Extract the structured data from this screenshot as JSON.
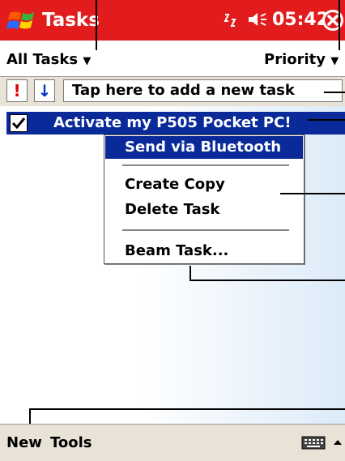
{
  "title_bar": {
    "app_title": "Tasks",
    "clock": "05:42"
  },
  "filter_bar": {
    "category": "All Tasks",
    "sort": "Priority"
  },
  "entry_bar": {
    "priority_symbol": "!",
    "sort_symbol": "↓",
    "new_task_placeholder": "Tap here to add a new task"
  },
  "task_list": {
    "tasks": [
      {
        "title": "Activate my P505 Pocket PC!",
        "checked": true
      }
    ]
  },
  "context_menu": {
    "items": [
      {
        "label": "Send via Bluetooth",
        "highlighted": true
      },
      {
        "label": "Create Copy"
      },
      {
        "label": "Delete Task"
      },
      {
        "label": "Beam Task..."
      }
    ]
  },
  "menu_bar": {
    "new": "New",
    "tools": "Tools"
  },
  "colors": {
    "title_bar": "#e21c1c",
    "selection": "#0a2a9a",
    "bar_background": "#e8e3d6"
  },
  "icons": [
    "windows-start-icon",
    "signal-icon",
    "speaker-icon",
    "close-icon",
    "dropdown-arrow-icon",
    "checkbox-checked-icon",
    "keyboard-icon",
    "up-arrow-icon"
  ]
}
